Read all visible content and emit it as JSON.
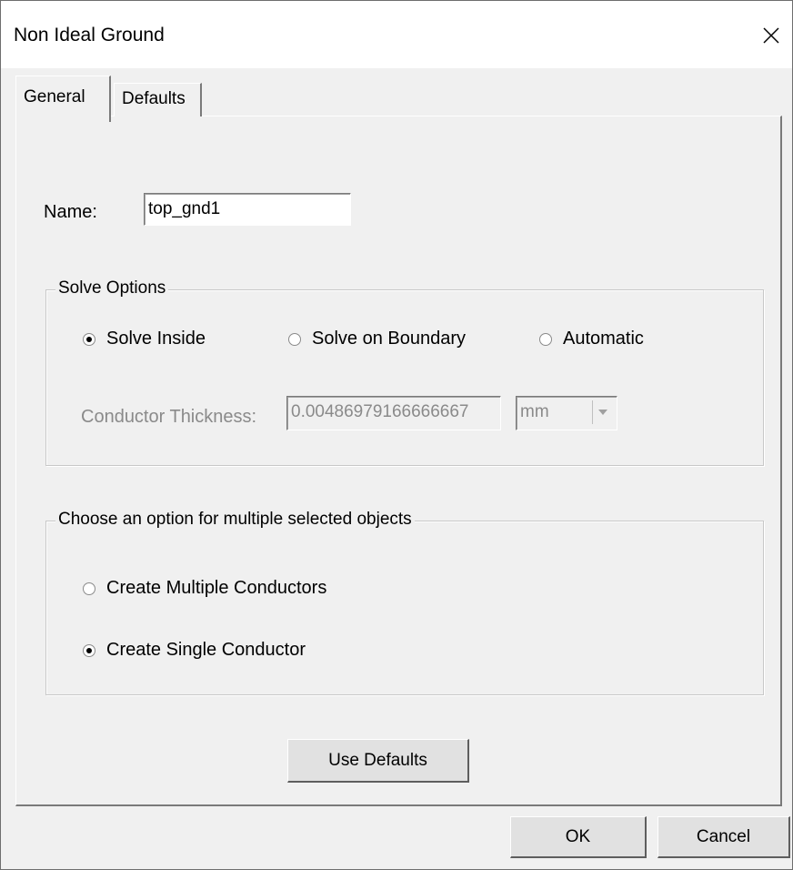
{
  "window": {
    "title": "Non Ideal Ground"
  },
  "tabs": [
    {
      "label": "General"
    },
    {
      "label": "Defaults"
    }
  ],
  "name_field": {
    "label": "Name:",
    "value": "top_gnd1"
  },
  "solve_options": {
    "title": "Solve Options",
    "options": [
      {
        "label": "Solve Inside",
        "checked": true
      },
      {
        "label": "Solve on Boundary",
        "checked": false
      },
      {
        "label": "Automatic",
        "checked": false
      }
    ],
    "conductor_thickness": {
      "label": "Conductor Thickness:",
      "value": "0.00486979166666667",
      "unit": "mm"
    }
  },
  "multi_select": {
    "title": "Choose an option for multiple selected objects",
    "options": [
      {
        "label": "Create Multiple Conductors",
        "checked": false
      },
      {
        "label": "Create Single Conductor",
        "checked": true
      }
    ]
  },
  "buttons": {
    "use_defaults": "Use Defaults",
    "ok": "OK",
    "cancel": "Cancel"
  },
  "icons": {
    "close": "close-icon",
    "dropdown": "chevron-down-icon"
  }
}
